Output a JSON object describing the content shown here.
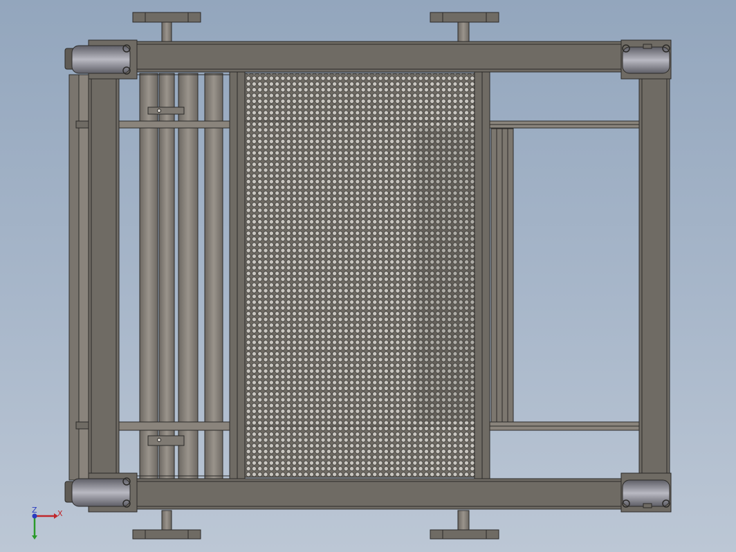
{
  "viewport": {
    "background_top": "#93a6bd",
    "background_bottom": "#bcc7d5",
    "model_fill": "#6f6b64",
    "model_fill_dark": "#5f5b55",
    "edge_color": "#2b2a28",
    "pipe_fill": "#868079",
    "caster_fill": "#8a8a94"
  },
  "triad": {
    "x_label": "X",
    "y_label": "",
    "z_label": "Z",
    "x_color": "#c0262b",
    "y_color": "#2a9a2a",
    "z_color": "#2a3bc0"
  }
}
